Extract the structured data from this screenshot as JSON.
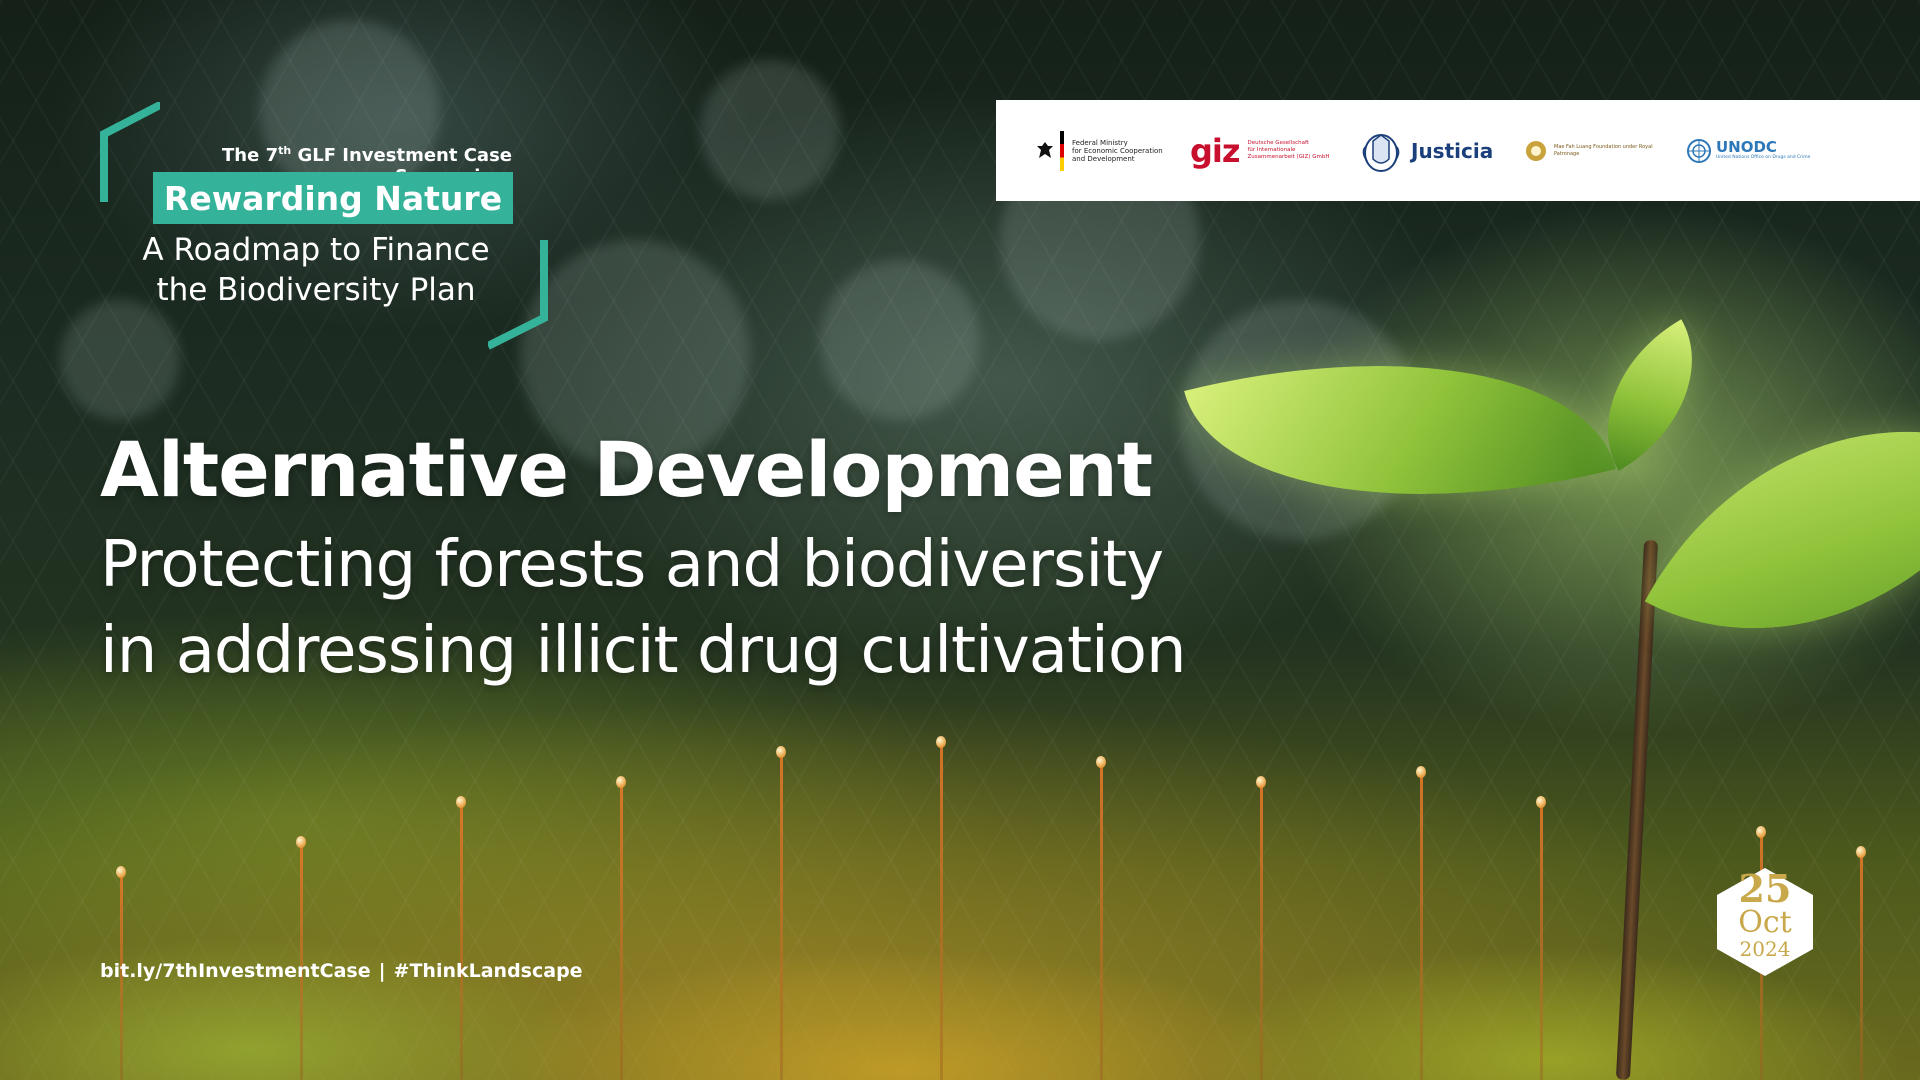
{
  "symposium": {
    "line_prefix": "The 7",
    "line_sup": "th",
    "line_suffix": " GLF Investment Case Symposium",
    "tag": "Rewarding Nature",
    "roadmap_line1": "A Roadmap to Finance",
    "roadmap_line2": "the Biodiversity Plan"
  },
  "logos": {
    "bmz_lines": [
      "Federal Ministry",
      "for Economic Cooperation",
      "and Development"
    ],
    "giz_mark": "giz",
    "giz_lines": [
      "Deutsche Gesellschaft",
      "für Internationale",
      "Zusammenarbeit (GIZ) GmbH"
    ],
    "justicia": "Justicia",
    "mfl_text": "Mae Fah Luang Foundation under Royal Patronage",
    "unodc_name": "UNODC",
    "unodc_sub": "United Nations Office on Drugs and Crime"
  },
  "main": {
    "title": "Alternative Development",
    "subtitle_line1": "Protecting forests and biodiversity",
    "subtitle_line2": "in addressing illicit drug cultivation"
  },
  "footer": {
    "link": "bit.ly/7thInvestmentCase",
    "separator": "|",
    "hashtag": "#ThinkLandscape"
  },
  "date": {
    "day": "25",
    "month": "Oct",
    "year": "2024"
  },
  "colors": {
    "accent": "#35b39a",
    "date_gold": "#c8a84a",
    "giz_red": "#c8102e",
    "justicia_blue": "#1a3f7a",
    "unodc_blue": "#2d78b8"
  },
  "icons": [
    "german-eagle-icon",
    "colombia-coat-of-arms-icon",
    "mae-fah-luang-emblem-icon",
    "un-emblem-icon",
    "hexagon-icon"
  ]
}
